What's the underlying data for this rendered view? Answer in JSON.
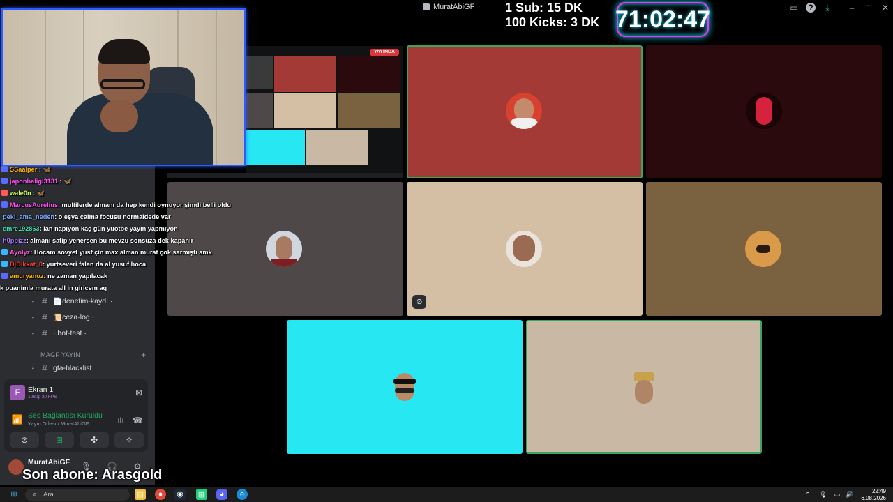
{
  "topbar": {
    "app_title": "MuratAbiGF",
    "sub_line_1": "1 Sub: 15 DK",
    "sub_line_2": "100 Kicks: 3 DK",
    "timer": "71:02:47"
  },
  "preview": {
    "live_badge": "YAYINDA"
  },
  "chat": [
    {
      "user": "SSaalper",
      "msg": "",
      "color": "#ffb100",
      "badge": "#5b6bff"
    },
    {
      "user": "japonbaligi3131",
      "msg": "",
      "color": "#ff4df5",
      "badge": "#5b6bff"
    },
    {
      "user": "wale0n",
      "msg": "",
      "color": "#c9ff5e",
      "badge": "#ff5a5a"
    },
    {
      "user": "MarcusAurelius",
      "msg": ": multilerde almanı da hep kendi oynuyor şimdi belli oldu",
      "color": "#ff4df5",
      "badge": "#5b6bff"
    },
    {
      "user": "peki_ama_neden",
      "msg": ": o eşya çalma focusu normaldede var",
      "color": "#7aa7ff",
      "badge": ""
    },
    {
      "user": "emre192863",
      "msg": ": lan napıyon kaç gün yuotbe yayın yapmıyon",
      "color": "#40e0b0",
      "badge": ""
    },
    {
      "user": "h0ppizz",
      "msg": ": almanı satip yenersen bu mevzu sonsuza dek kapanır",
      "color": "#a97bff",
      "badge": ""
    },
    {
      "user": "Ayolyz",
      "msg": ": Hocam sovyet yusf çin max alman murat çok sarmıştı amk",
      "color": "#ff5ad7",
      "badge": "#38b6ff"
    },
    {
      "user": "DjDikkat_0",
      "msg": ": yurtseveri falan da al yusuf hoca",
      "color": "#ff3b3b",
      "badge": "#38b6ff"
    },
    {
      "user": "amuryanoz",
      "msg": ": ne zaman yapılacak",
      "color": "#ffb100",
      "badge": "#5b6bff"
    },
    {
      "user": "",
      "msg": "k puanimla murata all in giricem aq",
      "color": "#ffffff",
      "badge": ""
    }
  ],
  "sidebar": {
    "channels": [
      {
        "icon": "📄",
        "label": "denetim-kaydı ·"
      },
      {
        "icon": "📜",
        "label": "ceza-log ·"
      },
      {
        "icon": "",
        "label": "· bot-test ·"
      }
    ],
    "category": "MAGF YAYIN",
    "channel_last": "gta-blacklist",
    "ekran_title": "Ekran 1",
    "ekran_sub": "1080p 30 FPS",
    "voice_status": "Ses Bağlantısı Kuruldu",
    "voice_sub": "Yayın Odası / MuratAbiGF",
    "user_name": "MuratAbiGF"
  },
  "overlay": {
    "last_sub": "Son abone: Arasgold"
  },
  "tiles": [
    {
      "bg": "#a33a35",
      "name": "tile-red-man"
    },
    {
      "bg": "#2a0a0c",
      "name": "tile-red-mask"
    },
    {
      "bg": "#4f4848",
      "name": "tile-bearded-man"
    },
    {
      "bg": "#d4bfa5",
      "name": "tile-man-selfie"
    },
    {
      "bg": "#7a6140",
      "name": "tile-dog"
    },
    {
      "bg": "#27e7f3",
      "name": "tile-sunglasses-man"
    },
    {
      "bg": "#c8b8a4",
      "name": "tile-crowned-man"
    }
  ],
  "taskbar": {
    "search_placeholder": "Ara",
    "time": "22:49",
    "date": "6.08.2026"
  }
}
